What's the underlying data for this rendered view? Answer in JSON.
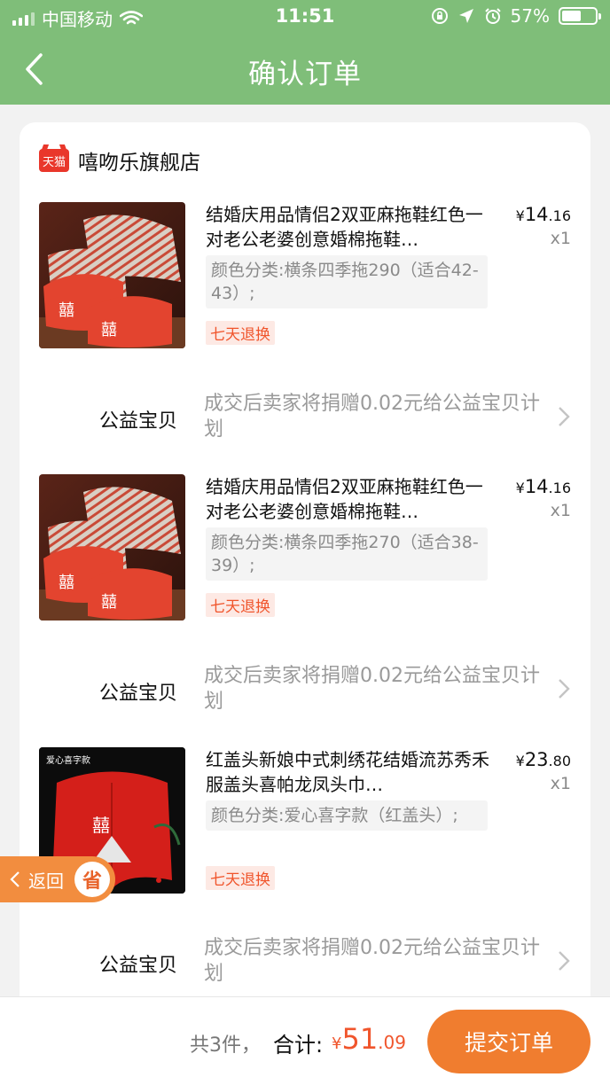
{
  "status_bar": {
    "carrier": "中国移动",
    "time": "11:51",
    "battery_text": "57%",
    "battery_level": 0.57
  },
  "nav": {
    "title": "确认订单"
  },
  "shop": {
    "badge": "天猫",
    "name": "嘻吻乐旗舰店"
  },
  "items": [
    {
      "title": "结婚庆用品情侣2双亚麻拖鞋红色一对老公老婆创意婚棉拖鞋…",
      "sku": "颜色分类:横条四季拖290（适合42-43）;",
      "tag": "七天退换",
      "price_currency": "¥",
      "price_int": "14",
      "price_dec": ".16",
      "qty": "x1",
      "charity_label": "公益宝贝",
      "charity_text": "成交后卖家将捐赠0.02元给公益宝贝计划"
    },
    {
      "title": "结婚庆用品情侣2双亚麻拖鞋红色一对老公老婆创意婚棉拖鞋…",
      "sku": "颜色分类:横条四季拖270（适合38-39）;",
      "tag": "七天退换",
      "price_currency": "¥",
      "price_int": "14",
      "price_dec": ".16",
      "qty": "x1",
      "charity_label": "公益宝贝",
      "charity_text": "成交后卖家将捐赠0.02元给公益宝贝计划"
    },
    {
      "title": "红盖头新娘中式刺绣花结婚流苏秀禾服盖头喜帕龙凤头巾…",
      "sku": "颜色分类:爱心喜字款（红盖头）;",
      "tag": "七天退换",
      "price_currency": "¥",
      "price_int": "23",
      "price_dec": ".80",
      "qty": "x1",
      "charity_label": "公益宝贝",
      "charity_text": "成交后卖家将捐赠0.02元给公益宝贝计划",
      "thumb_caption": "爱心喜字款"
    }
  ],
  "float_back": {
    "label": "返回",
    "badge": "省"
  },
  "footer": {
    "count": "共3件，",
    "total_label": "合计:",
    "total_currency": "¥",
    "total_int": "51",
    "total_dec": ".09",
    "submit": "提交订单"
  },
  "colors": {
    "header": "#7fbe79",
    "accent": "#f07d2f",
    "price_red": "#f0552c",
    "tmall": "#e9372b"
  }
}
